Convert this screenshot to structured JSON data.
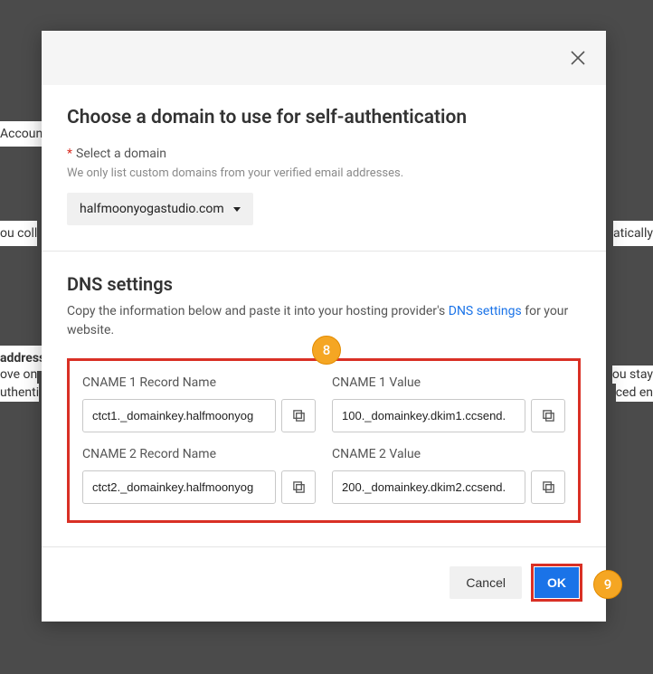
{
  "background": {
    "account": "Accoun",
    "collect": "ou coll",
    "automatically": "atically",
    "address": "address",
    "move_on": "ove on",
    "authenti": "uthenti",
    "you_stay": "ou stay",
    "ced_en": "ced en"
  },
  "modal": {
    "title": "Choose a domain to use for self-authentication",
    "select_label": "Select a domain",
    "select_help": "We only list custom domains from your verified email addresses.",
    "selected_domain": "halfmoonyogastudio.com",
    "dns_title": "DNS settings",
    "dns_desc_before": "Copy the information below and paste it into your hosting provider's ",
    "dns_link": "DNS settings",
    "dns_desc_after": " for your website.",
    "badge8": "8",
    "badge9": "9",
    "fields": {
      "cname1_name_label": "CNAME 1 Record Name",
      "cname1_name_value": "ctct1._domainkey.halfmoonyog",
      "cname1_value_label": "CNAME 1 Value",
      "cname1_value_value": "100._domainkey.dkim1.ccsend.",
      "cname2_name_label": "CNAME 2 Record Name",
      "cname2_name_value": "ctct2._domainkey.halfmoonyog",
      "cname2_value_label": "CNAME 2 Value",
      "cname2_value_value": "200._domainkey.dkim2.ccsend."
    },
    "cancel": "Cancel",
    "ok": "OK"
  }
}
